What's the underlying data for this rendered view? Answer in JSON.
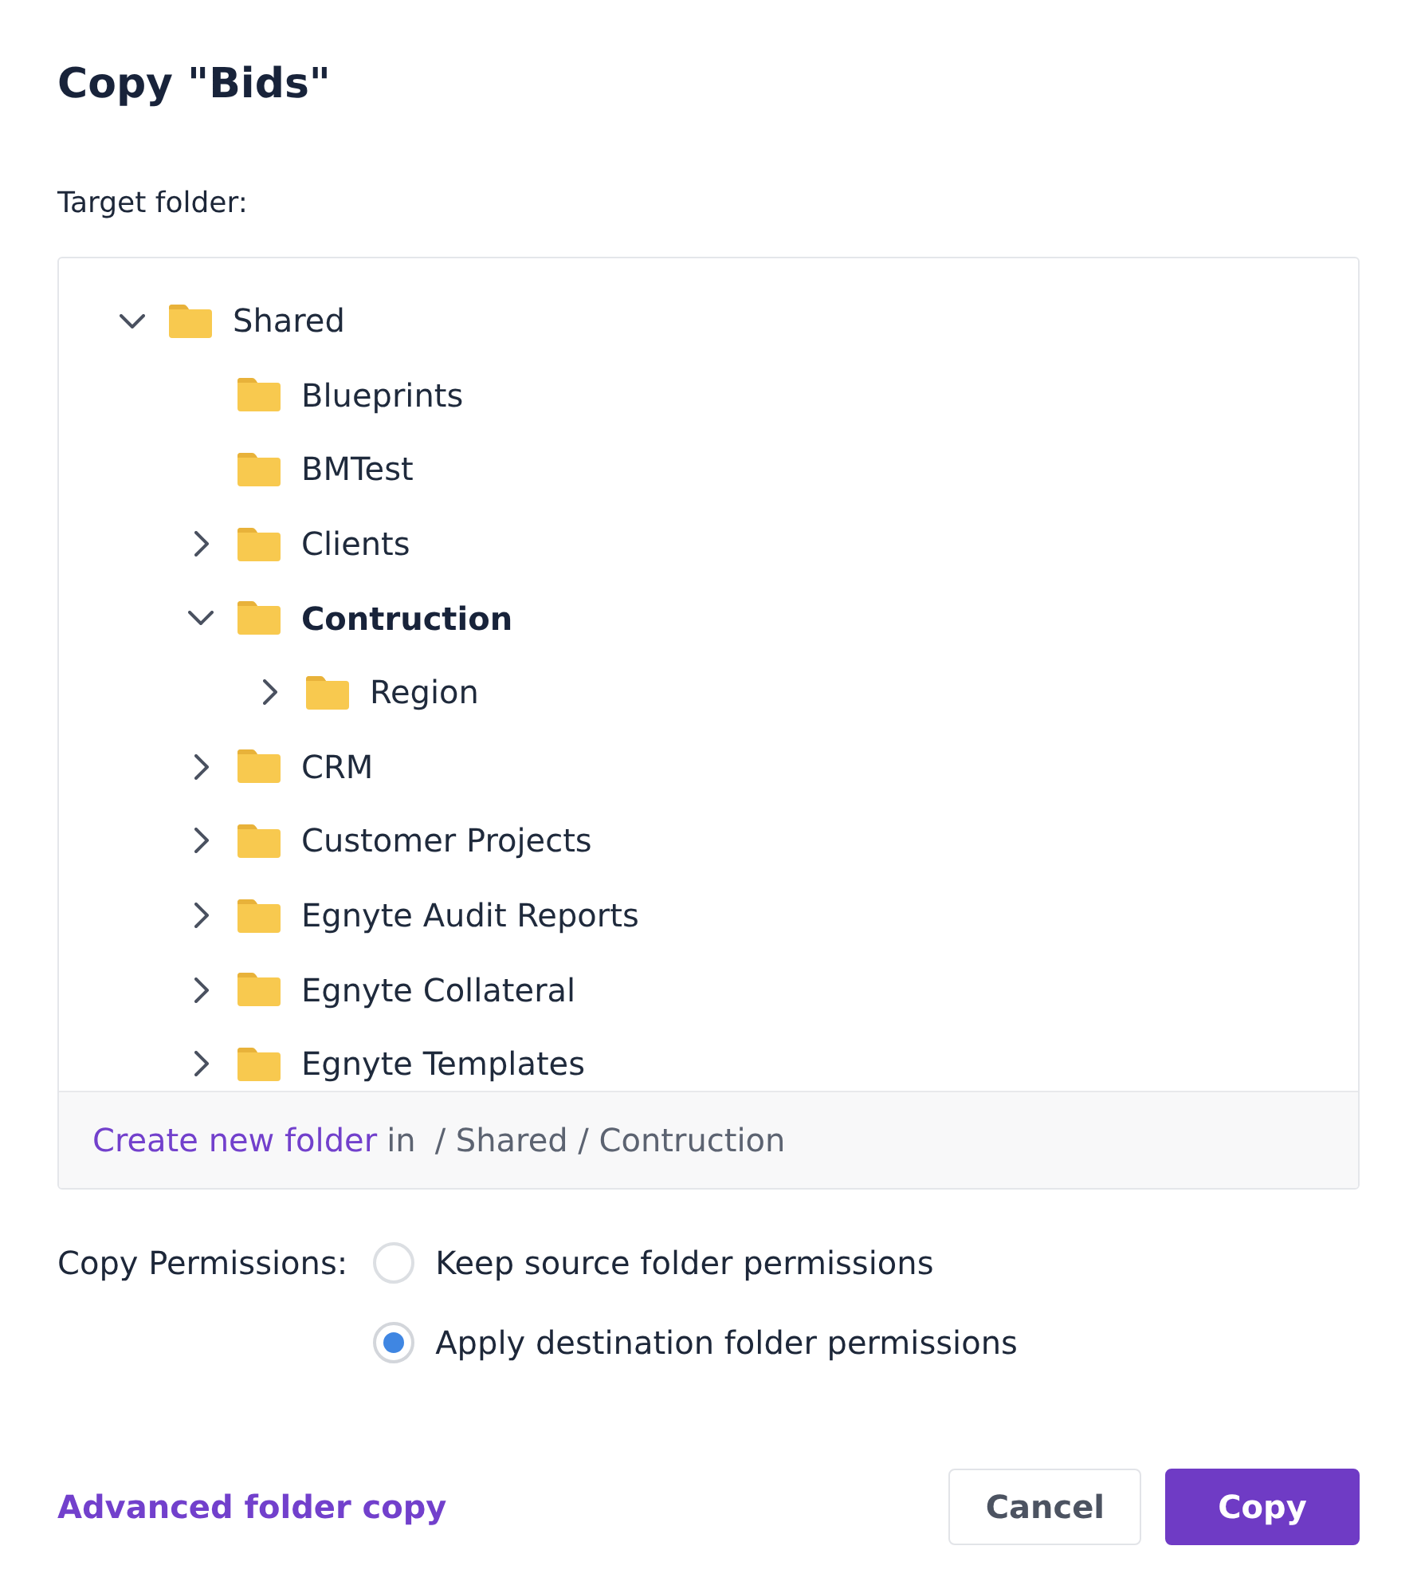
{
  "dialog": {
    "title": "Copy \"Bids\""
  },
  "target": {
    "label": "Target folder:"
  },
  "tree": {
    "items": [
      {
        "label": "Shared",
        "expandable": true,
        "expanded": true,
        "selected": false,
        "children": [
          {
            "label": "Blueprints",
            "expandable": false,
            "selected": false
          },
          {
            "label": "BMTest",
            "expandable": false,
            "selected": false
          },
          {
            "label": "Clients",
            "expandable": true,
            "expanded": false,
            "selected": false
          },
          {
            "label": "Contruction",
            "expandable": true,
            "expanded": true,
            "selected": true,
            "children": [
              {
                "label": "Region",
                "expandable": true,
                "expanded": false,
                "selected": false
              }
            ]
          },
          {
            "label": "CRM",
            "expandable": true,
            "expanded": false,
            "selected": false
          },
          {
            "label": "Customer Projects",
            "expandable": true,
            "expanded": false,
            "selected": false
          },
          {
            "label": "Egnyte Audit Reports",
            "expandable": true,
            "expanded": false,
            "selected": false
          },
          {
            "label": "Egnyte Collateral",
            "expandable": true,
            "expanded": false,
            "selected": false
          },
          {
            "label": "Egnyte Templates",
            "expandable": true,
            "expanded": false,
            "selected": false
          }
        ]
      }
    ]
  },
  "tree_footer": {
    "link": "Create new folder",
    "connector": "in",
    "path": "/ Shared / Contruction"
  },
  "permissions": {
    "label": "Copy Permissions:",
    "options": [
      {
        "label": "Keep source folder permissions",
        "selected": false
      },
      {
        "label": "Apply destination folder permissions",
        "selected": true
      }
    ]
  },
  "actions": {
    "link": "Advanced folder copy",
    "buttons": [
      {
        "label": "Cancel",
        "kind": "secondary"
      },
      {
        "label": "Copy",
        "kind": "primary"
      }
    ]
  }
}
